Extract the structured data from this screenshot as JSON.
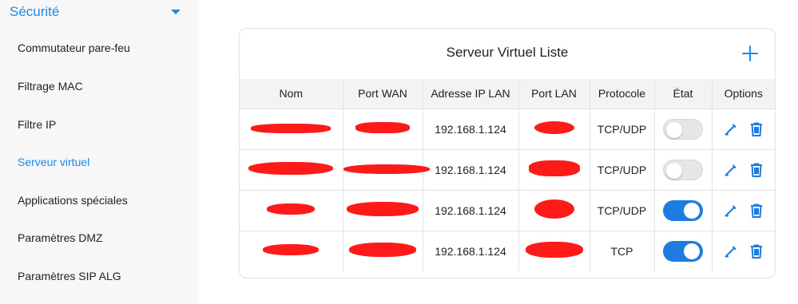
{
  "colors": {
    "accent": "#1e88e5",
    "toggle_on": "#1e7be0",
    "redaction": "#ff1a1a"
  },
  "sidebar": {
    "section_title": "Sécurité",
    "items": [
      {
        "label": "Commutateur pare-feu",
        "active": false
      },
      {
        "label": "Filtrage MAC",
        "active": false
      },
      {
        "label": "Filtre IP",
        "active": false
      },
      {
        "label": "Serveur virtuel",
        "active": true
      },
      {
        "label": "Applications spéciales",
        "active": false
      },
      {
        "label": "Paramètres DMZ",
        "active": false
      },
      {
        "label": "Paramètres SIP ALG",
        "active": false
      }
    ]
  },
  "panel": {
    "title": "Serveur Virtuel Liste",
    "add_icon": "plus-icon",
    "columns": [
      "Nom",
      "Port WAN",
      "Adresse IP LAN",
      "Port LAN",
      "Protocole",
      "État",
      "Options"
    ],
    "rows": [
      {
        "ip": "192.168.1.124",
        "protocol": "TCP/UDP",
        "enabled": false
      },
      {
        "ip": "192.168.1.124",
        "protocol": "TCP/UDP",
        "enabled": false
      },
      {
        "ip": "192.168.1.124",
        "protocol": "TCP/UDP",
        "enabled": true
      },
      {
        "ip": "192.168.1.124",
        "protocol": "TCP",
        "enabled": true
      }
    ],
    "row_icons": [
      "edit-icon",
      "trash-icon"
    ]
  }
}
